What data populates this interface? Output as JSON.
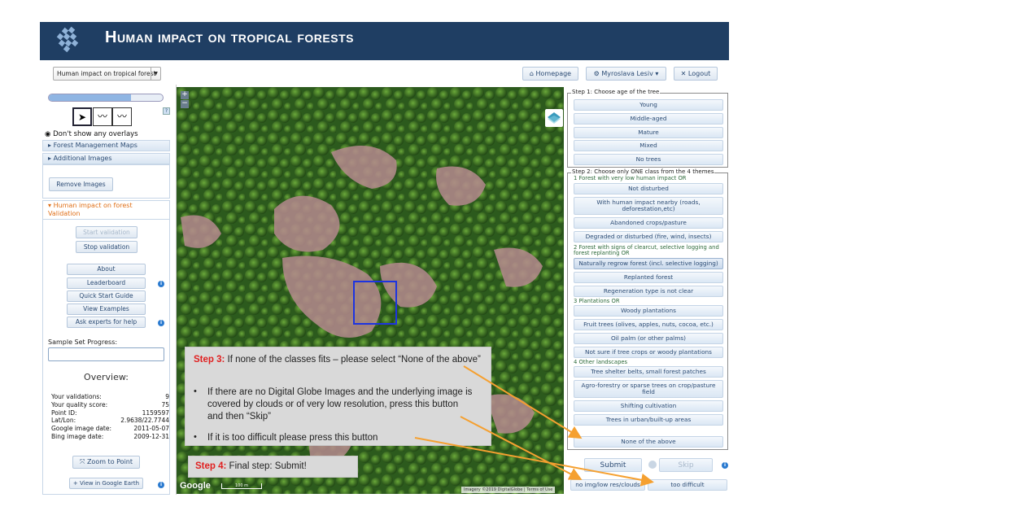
{
  "banner": {
    "title": "Human impact on tropical forests"
  },
  "topbar": {
    "project_select": "Human impact on tropical forest",
    "homepage": "Homepage",
    "user": "Myroslava Lesiv",
    "logout": "Logout"
  },
  "sidebar": {
    "opacity": 0.72,
    "no_overlays": "Don't show any overlays",
    "forest_maps": "Forest Management Maps",
    "additional_images": "Additional Images",
    "remove_images": "Remove Images",
    "validation_title": "Human impact on forest Validation",
    "start_validation": "Start validation",
    "stop_validation": "Stop validation",
    "about": "About",
    "leaderboard": "Leaderboard",
    "quick_start": "Quick Start Guide",
    "view_examples": "View Examples",
    "ask_experts": "Ask experts for help",
    "sample_progress_label": "Sample Set Progress:",
    "overview_title": "Overview:",
    "overview": [
      {
        "label": "Your validations:",
        "value": "9"
      },
      {
        "label": "Your quality score:",
        "value": "75"
      },
      {
        "label": "Point ID:",
        "value": "1159597"
      },
      {
        "label": "Lat/Lon:",
        "value": "2.9638/22.7744"
      },
      {
        "label": "Google image date:",
        "value": "2011-05-07"
      },
      {
        "label": "Bing image date:",
        "value": "2009-12-31"
      }
    ],
    "zoom_to_point": "Zoom to Point",
    "view_google_earth": "View in Google Earth"
  },
  "map": {
    "google_logo": "Google",
    "scale": "100 m",
    "copyright": "Imagery ©2019 DigitalGlobe | Terms of Use"
  },
  "step1": {
    "legend": "Step 1: Choose age of the tree",
    "options": [
      "Young",
      "Middle-aged",
      "Mature",
      "Mixed",
      "No trees"
    ]
  },
  "step2": {
    "legend": "Step 2: Choose only ONE class from the 4 themes",
    "theme1": "1 Forest with very low human impact OR",
    "t1": [
      "Not disturbed",
      "With human impact nearby (roads, deforestation,etc)",
      "Abandoned crops/pasture",
      "Degraded or disturbed (fire, wind, insects)"
    ],
    "theme2": "2 Forest with signs of clearcut, selective logging and forest replanting OR",
    "t2": [
      "Naturally regrow forest (incl. selective logging)",
      "Replanted forest",
      "Regeneration type is not clear"
    ],
    "theme3": "3 Plantations OR",
    "t3": [
      "Woody plantations",
      "Fruit trees (olives, apples, nuts, cocoa, etc.)",
      "Oil palm (or other palms)",
      "Not sure if tree crops or woody plantations"
    ],
    "theme4": "4 Other landscapes",
    "t4": [
      "Tree shelter belts, small forest patches",
      "Agro-forestry or sparse trees on crop/pasture field",
      "Shifting cultivation",
      "Trees in urban/built-up areas"
    ],
    "none": "None of the above"
  },
  "actions": {
    "submit": "Submit",
    "skip": "Skip",
    "no_img": "no img/low res/clouds",
    "too_difficult": "too difficult"
  },
  "callout3": {
    "step": "Step 3:",
    "text": " If none of the classes fits – please select “None of the above”",
    "bullet1": "If there are no Digital Globe Images and the underlying image is covered  by clouds or of very low resolution, press this button and then “Skip”",
    "bullet2": "If it is too difficult please press this button"
  },
  "callout4": {
    "step": "Step 4:",
    "text": " Final step: Submit!"
  },
  "colors": {
    "banner": "#1f3e63",
    "arrow": "#f5a030",
    "step_red": "#e02020"
  }
}
